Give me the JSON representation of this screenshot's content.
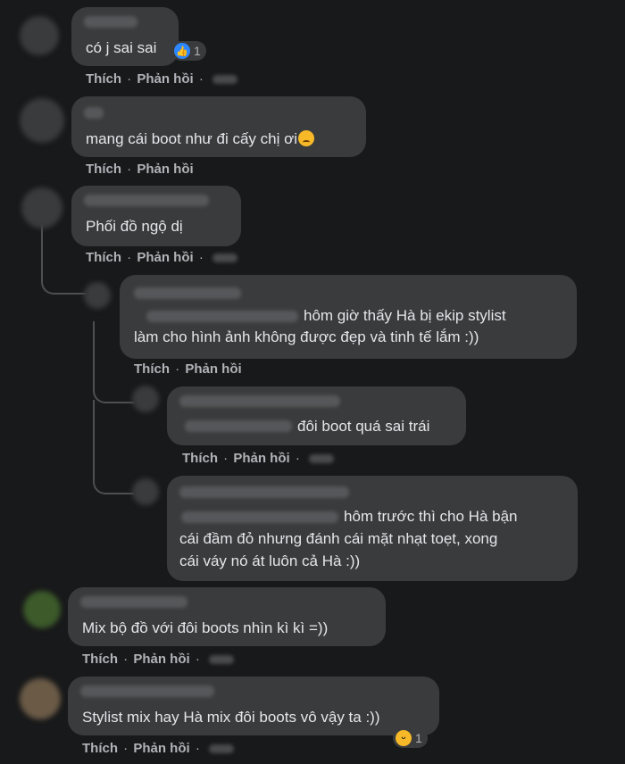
{
  "actions": {
    "like": "Thích",
    "reply": "Phản hồi",
    "sep": "·"
  },
  "comments": [
    {
      "text": "có j sai sai",
      "reaction_count": "1"
    },
    {
      "text": "mang cái boot như đi cấy chị ơi"
    },
    {
      "text": "Phối đồ ngộ dị"
    },
    {
      "lines": [
        "hôm giờ thấy Hà bị ekip stylist",
        "làm cho hình ảnh không được đẹp và tinh tế lắm :))"
      ]
    },
    {
      "text": "đôi boot quá sai trái"
    },
    {
      "lines": [
        "hôm trước thì cho Hà bận",
        "cái đầm đỏ nhưng đánh cái mặt nhạt toẹt, xong",
        "cái váy nó át luôn cả Hà :))"
      ]
    },
    {
      "text": "Mix bộ đồ với đôi boots nhìn kì kì =))"
    },
    {
      "text": "Stylist mix hay Hà mix đôi boots vô vậy ta :))",
      "reaction_count": "1"
    }
  ],
  "icons": {
    "like": "like-icon",
    "haha": "haha-icon",
    "sad": "sad-face-emoji"
  },
  "colors": {
    "background": "#18191a",
    "bubble": "#3a3b3c",
    "text": "#e4e6eb",
    "meta": "#b0b3b8",
    "like_blue": "#2d88ff"
  }
}
